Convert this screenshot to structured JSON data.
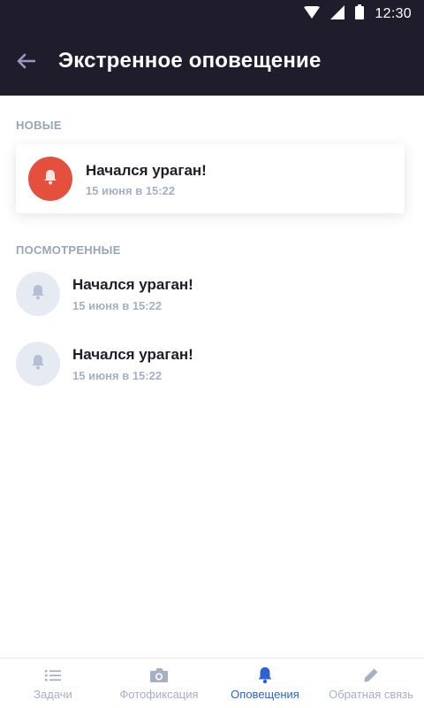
{
  "status_bar": {
    "time": "12:30"
  },
  "header": {
    "title": "Экстренное оповещение"
  },
  "sections": {
    "new_label": "НОВЫЕ",
    "seen_label": "ПОСМОТРЕННЫЕ"
  },
  "new_items": [
    {
      "title": "Начался ураган!",
      "date": "15 июня в 15:22",
      "icon": "bell-icon"
    }
  ],
  "seen_items": [
    {
      "title": "Начался ураган!",
      "date": "15 июня в 15:22",
      "icon": "bell-icon"
    },
    {
      "title": "Начался ураган!",
      "date": "15 июня в 15:22",
      "icon": "bell-icon"
    }
  ],
  "bottom_nav": {
    "items": [
      {
        "label": "Задачи",
        "icon": "list-icon",
        "active": false
      },
      {
        "label": "Фотофиксация",
        "icon": "camera-icon",
        "active": false
      },
      {
        "label": "Оповещения",
        "icon": "bell-icon",
        "active": true
      },
      {
        "label": "Обратная связь",
        "icon": "pencil-icon",
        "active": false
      }
    ]
  },
  "colors": {
    "header_bg": "#1f1d2b",
    "alert_red": "#e5503e",
    "seen_bg": "#e6ebf3",
    "active_blue": "#2d62d6",
    "muted_text": "#a6b0c2"
  }
}
